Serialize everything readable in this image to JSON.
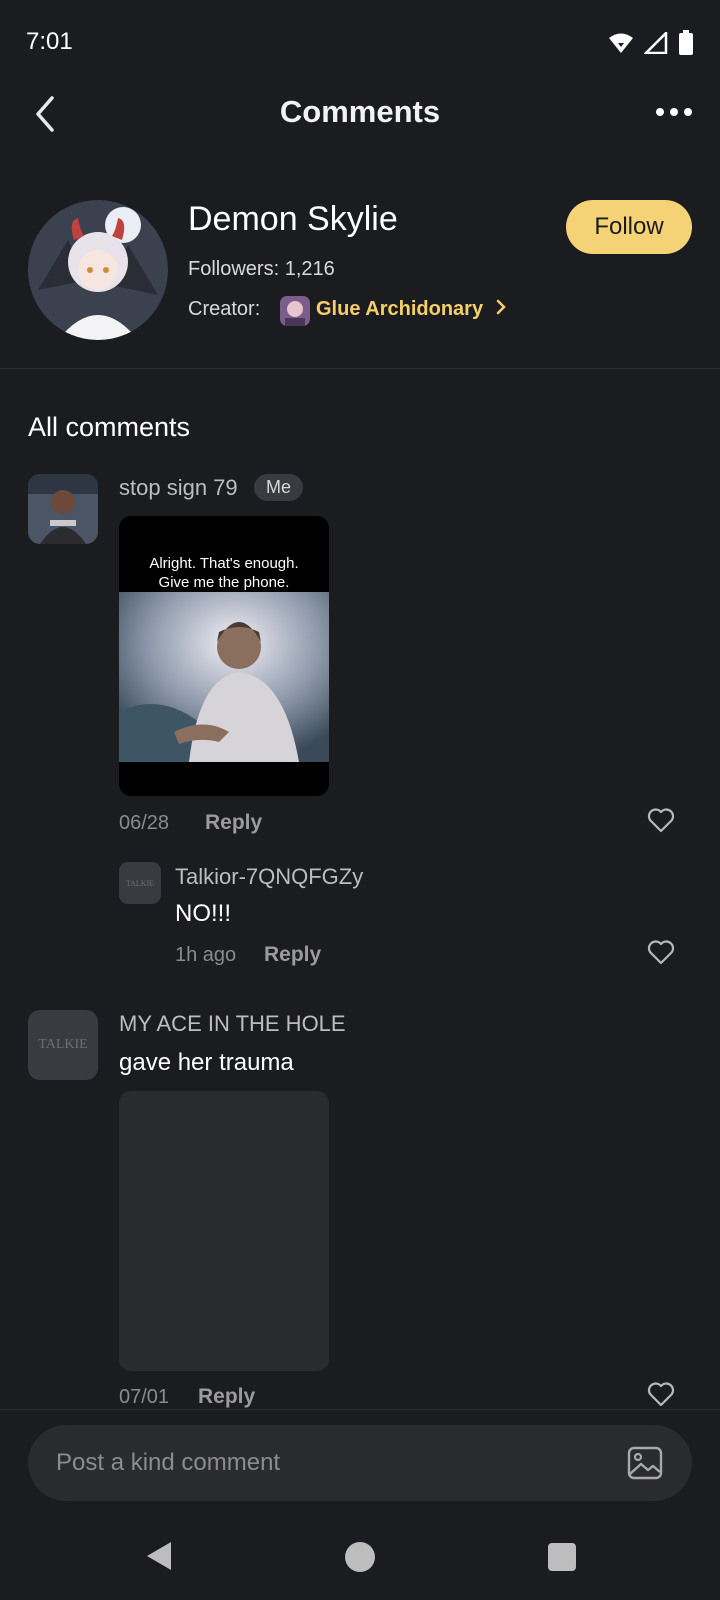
{
  "status_bar": {
    "time": "7:01",
    "icons": [
      "wifi-icon",
      "signal-icon",
      "battery-icon"
    ]
  },
  "header": {
    "title": "Comments",
    "back_icon": "chevron-left-icon",
    "more_icon": "more-horizontal-icon"
  },
  "profile": {
    "name": "Demon Skylie",
    "followers": "Followers: 1,216",
    "creator_label": "Creator:",
    "creator_name": "Glue Archidonary",
    "follow_label": "Follow"
  },
  "comments_section": {
    "title": "All comments"
  },
  "comments": [
    {
      "user": "stop sign 79",
      "badge": "Me",
      "image_caption": "Alright. That's enough.\nGive me the phone.",
      "date": "06/28",
      "reply_label": "Reply",
      "replies": [
        {
          "user": "Talkior-7QNQFGZy",
          "text": "NO!!!",
          "date": "1h ago",
          "reply_label": "Reply",
          "avatar_text": "TALKIE"
        }
      ]
    },
    {
      "user": "MY ACE IN THE HOLE",
      "text": "gave her trauma",
      "date": "07/01",
      "reply_label": "Reply",
      "avatar_text": "TALKIE"
    }
  ],
  "input": {
    "placeholder": "Post a kind comment",
    "image_icon": "image-icon"
  },
  "colors": {
    "background": "#1b1c1f",
    "accent": "#f6d277",
    "creator_link": "#f6cf6a"
  }
}
